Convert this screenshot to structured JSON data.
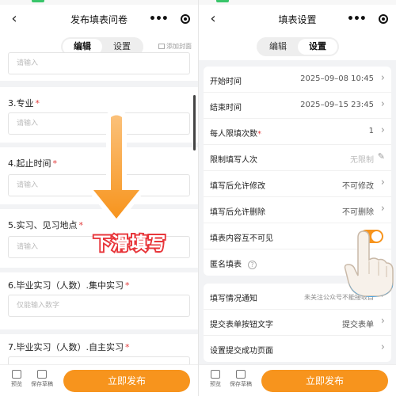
{
  "left": {
    "title": "发布填表问卷",
    "tabs": [
      "编辑",
      "设置"
    ],
    "active_tab": "编辑",
    "add_cover": "添加封面",
    "top_placeholder": "请输入",
    "fields": [
      {
        "label": "3.专业",
        "required": true,
        "placeholder": "请输入"
      },
      {
        "label": "4.起止时间",
        "required": true,
        "placeholder": "请输入"
      },
      {
        "label": "5.实习、见习地点",
        "required": true,
        "placeholder": "请输入"
      },
      {
        "label": "6.毕业实习（人数）.集中实习",
        "required": true,
        "placeholder": "仅能输入数字"
      },
      {
        "label": "7.毕业实习（人数）.自主实习",
        "required": true,
        "placeholder": ""
      }
    ],
    "bottom": {
      "preview": "预览",
      "save_draft": "保存草稿",
      "publish": "立即发布"
    }
  },
  "right": {
    "title": "填表设置",
    "tabs": [
      "编辑",
      "设置"
    ],
    "active_tab": "设置",
    "rows": [
      {
        "label": "开始时间",
        "value": "2025–09–08 10:45",
        "control": "chevron"
      },
      {
        "label": "结束时间",
        "value": "2025–09–15 23:45",
        "control": "chevron"
      },
      {
        "label": "每人限填次数",
        "required": true,
        "value": "1",
        "control": "chevron"
      },
      {
        "label": "限制填写人次",
        "value": "无限制",
        "control": "pencil"
      },
      {
        "label": "填写后允许修改",
        "value": "不可修改",
        "control": "chevron"
      },
      {
        "label": "填写后允许删除",
        "value": "不可删除",
        "control": "chevron"
      },
      {
        "label": "填表内容互不可见",
        "value": "",
        "control": "toggle",
        "toggle_on": true
      },
      {
        "label": "匿名填表",
        "value": "",
        "control": "help"
      },
      {
        "label": "填写情况通知",
        "value": "未关注公众号不能接收自",
        "control": "chevron"
      },
      {
        "label": "提交表单按钮文字",
        "value": "提交表单",
        "control": "chevron"
      },
      {
        "label": "设置提交成功页面",
        "value": "",
        "control": "chevron"
      }
    ],
    "bottom": {
      "preview": "预览",
      "save_draft": "保存草稿",
      "publish": "立即发布"
    }
  },
  "overlay": {
    "caption": "下滑填写"
  },
  "colors": {
    "accent": "#f7941d",
    "required": "#e23b3b",
    "caption_outline": "#e8363b"
  }
}
